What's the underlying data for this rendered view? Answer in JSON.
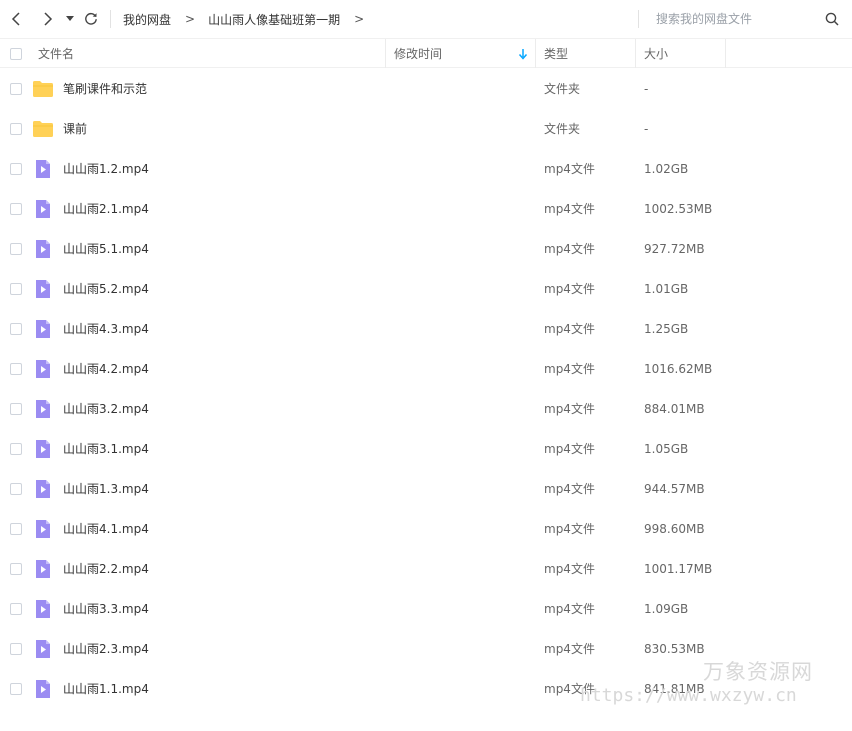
{
  "breadcrumb": {
    "items": [
      "我的网盘",
      "山山雨人像基础班第一期"
    ],
    "separator": ">"
  },
  "search": {
    "placeholder": "搜索我的网盘文件"
  },
  "columns": {
    "name": "文件名",
    "modified": "修改时间",
    "type": "类型",
    "size": "大小"
  },
  "files": [
    {
      "name": "笔刷课件和示范",
      "type": "文件夹",
      "size": "-",
      "icon": "folder-icon"
    },
    {
      "name": "课前",
      "type": "文件夹",
      "size": "-",
      "icon": "folder-icon"
    },
    {
      "name": "山山雨1.2.mp4",
      "type": "mp4文件",
      "size": "1.02GB",
      "icon": "video-file-icon"
    },
    {
      "name": "山山雨2.1.mp4",
      "type": "mp4文件",
      "size": "1002.53MB",
      "icon": "video-file-icon"
    },
    {
      "name": "山山雨5.1.mp4",
      "type": "mp4文件",
      "size": "927.72MB",
      "icon": "video-file-icon"
    },
    {
      "name": "山山雨5.2.mp4",
      "type": "mp4文件",
      "size": "1.01GB",
      "icon": "video-file-icon"
    },
    {
      "name": "山山雨4.3.mp4",
      "type": "mp4文件",
      "size": "1.25GB",
      "icon": "video-file-icon"
    },
    {
      "name": "山山雨4.2.mp4",
      "type": "mp4文件",
      "size": "1016.62MB",
      "icon": "video-file-icon"
    },
    {
      "name": "山山雨3.2.mp4",
      "type": "mp4文件",
      "size": "884.01MB",
      "icon": "video-file-icon"
    },
    {
      "name": "山山雨3.1.mp4",
      "type": "mp4文件",
      "size": "1.05GB",
      "icon": "video-file-icon"
    },
    {
      "name": "山山雨1.3.mp4",
      "type": "mp4文件",
      "size": "944.57MB",
      "icon": "video-file-icon"
    },
    {
      "name": "山山雨4.1.mp4",
      "type": "mp4文件",
      "size": "998.60MB",
      "icon": "video-file-icon"
    },
    {
      "name": "山山雨2.2.mp4",
      "type": "mp4文件",
      "size": "1001.17MB",
      "icon": "video-file-icon"
    },
    {
      "name": "山山雨3.3.mp4",
      "type": "mp4文件",
      "size": "1.09GB",
      "icon": "video-file-icon"
    },
    {
      "name": "山山雨2.3.mp4",
      "type": "mp4文件",
      "size": "830.53MB",
      "icon": "video-file-icon"
    },
    {
      "name": "山山雨1.1.mp4",
      "type": "mp4文件",
      "size": "841.81MB",
      "icon": "video-file-icon"
    }
  ],
  "watermark": {
    "line1": "万象资源网",
    "line2": "https://www.wxzyw.cn"
  },
  "colors": {
    "folder": "#ffd157",
    "video": "#9b8cf2",
    "sort_arrow": "#06a7ff"
  }
}
